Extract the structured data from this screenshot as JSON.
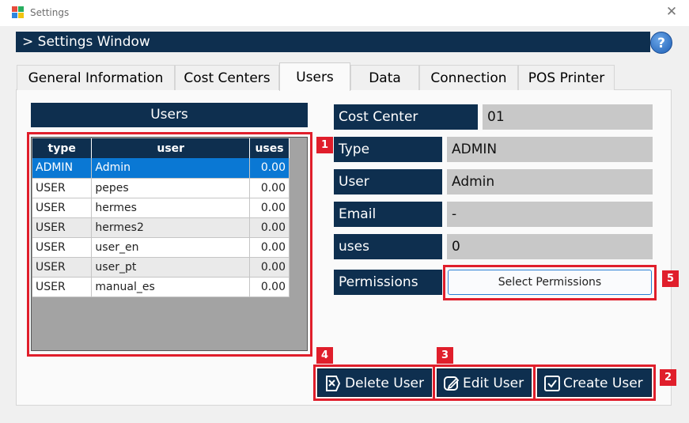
{
  "window": {
    "title": "Settings",
    "close_glyph": "✕"
  },
  "header": {
    "title": "> Settings Window",
    "help_glyph": "?"
  },
  "tabs": [
    {
      "label": "General Information"
    },
    {
      "label": "Cost Centers"
    },
    {
      "label": "Users"
    },
    {
      "label": "Data"
    },
    {
      "label": "Connection"
    },
    {
      "label": "POS Printer"
    }
  ],
  "users_panel": {
    "title": "Users",
    "columns": [
      "type",
      "user",
      "uses"
    ],
    "rows": [
      {
        "type": "ADMIN",
        "user": "Admin",
        "uses": "0.00"
      },
      {
        "type": "USER",
        "user": "pepes",
        "uses": "0.00"
      },
      {
        "type": "USER",
        "user": "hermes",
        "uses": "0.00"
      },
      {
        "type": "USER",
        "user": "hermes2",
        "uses": "0.00"
      },
      {
        "type": "USER",
        "user": "user_en",
        "uses": "0.00"
      },
      {
        "type": "USER",
        "user": "user_pt",
        "uses": "0.00"
      },
      {
        "type": "USER",
        "user": "manual_es",
        "uses": "0.00"
      }
    ]
  },
  "details": {
    "cost_center_label": "Cost Center",
    "cost_center_value": "01",
    "type_label": "Type",
    "type_value": "ADMIN",
    "user_label": "User",
    "user_value": "Admin",
    "email_label": "Email",
    "email_value": "-",
    "uses_label": "uses",
    "uses_value": "0",
    "permissions_label": "Permissions",
    "permissions_button": "Select Permissions"
  },
  "actions": {
    "delete": "Delete User",
    "edit": "Edit User",
    "create": "Create User"
  },
  "annotations": [
    "1",
    "2",
    "3",
    "4",
    "5"
  ],
  "colors": {
    "navy": "#0e2f4f",
    "selection": "#0a78d4",
    "annotation_red": "#e01e2b",
    "value_bg": "#c8c8c8"
  }
}
